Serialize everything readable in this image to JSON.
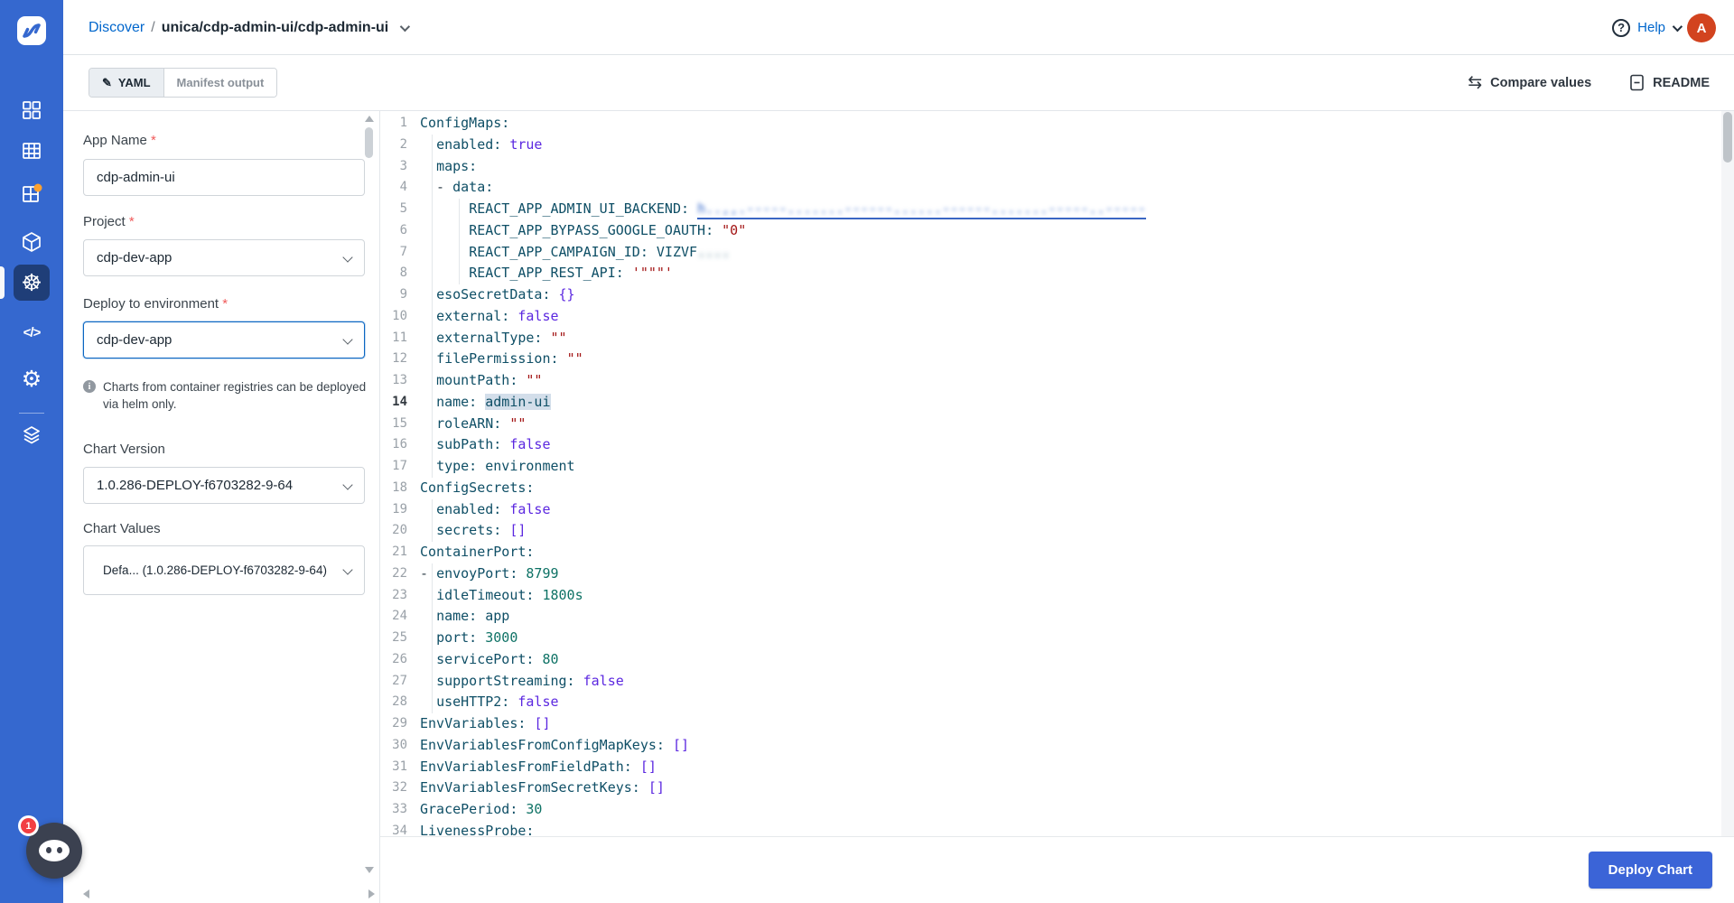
{
  "colors": {
    "sidebar_blue": "#3568cf",
    "sidebar_active_bg": "#1f3e78",
    "link_blue": "#0066cc",
    "deploy_button_blue": "#3b64d7",
    "avatar_orange": "#d2431f",
    "notification_dot_orange": "#fca130",
    "badge_red": "#f23f43",
    "code_key": "#0f4f66",
    "code_atom": "#5b27e0",
    "code_number": "#0e7265",
    "code_string": "#a31515",
    "code_selection_bg": "#d3deea"
  },
  "sidebar": {
    "icons": [
      "devtron-logo",
      "apps-grid-icon",
      "chart-store-icon",
      "deployment-groups-icon",
      "resource-cube-icon",
      "helm-wheel-icon",
      "code-icon",
      "gear-icon",
      "stack-icon"
    ],
    "active_item": "helm-wheel-icon"
  },
  "header": {
    "breadcrumb": {
      "section": "Discover",
      "separator": "/",
      "path": "unica/cdp-admin-ui/cdp-admin-ui"
    },
    "help_label": "Help",
    "avatar_initial": "A"
  },
  "toolbar": {
    "yaml_tab": "YAML",
    "manifest_tab": "Manifest output",
    "compare_label": "Compare values",
    "readme_label": "README"
  },
  "form": {
    "app_name": {
      "label": "App Name",
      "required_mark": "*",
      "value": "cdp-admin-ui"
    },
    "project": {
      "label": "Project",
      "required_mark": "*",
      "value": "cdp-dev-app"
    },
    "environment": {
      "label": "Deploy to environment",
      "required_mark": "*",
      "value": "cdp-dev-app"
    },
    "note": "Charts from container registries can be deployed via helm only.",
    "chart_version": {
      "label": "Chart Version",
      "value": "1.0.286-DEPLOY-f6703282-9-64"
    },
    "chart_values": {
      "label": "Chart Values",
      "value": "Defa... (1.0.286-DEPLOY-f6703282-9-64)"
    }
  },
  "editor": {
    "lines": [
      {
        "n": 1,
        "seg": [
          [
            "key",
            "ConfigMaps:"
          ]
        ]
      },
      {
        "n": 2,
        "seg": [
          [
            "pln",
            "  "
          ],
          [
            "key",
            "enabled:"
          ],
          [
            "pln",
            " "
          ],
          [
            "atm",
            "true"
          ]
        ]
      },
      {
        "n": 3,
        "seg": [
          [
            "pln",
            "  "
          ],
          [
            "key",
            "maps:"
          ]
        ]
      },
      {
        "n": 4,
        "seg": [
          [
            "pln",
            "  - "
          ],
          [
            "key",
            "data:"
          ]
        ]
      },
      {
        "n": 5,
        "seg": [
          [
            "pln",
            "      "
          ],
          [
            "key",
            "REACT_APP_ADMIN_UI_BACKEND:"
          ],
          [
            "pln",
            " "
          ],
          [
            "lnk",
            "h..,,.-----.......------......------.......-----..-----"
          ]
        ]
      },
      {
        "n": 6,
        "seg": [
          [
            "pln",
            "      "
          ],
          [
            "key",
            "REACT_APP_BYPASS_GOOGLE_OAUTH:"
          ],
          [
            "pln",
            " "
          ],
          [
            "str",
            "\"0\""
          ]
        ]
      },
      {
        "n": 7,
        "seg": [
          [
            "pln",
            "      "
          ],
          [
            "key",
            "REACT_APP_CAMPAIGN_ID:"
          ],
          [
            "pln",
            " "
          ],
          [
            "val",
            "VIZVF"
          ],
          [
            "blr",
            "...."
          ]
        ]
      },
      {
        "n": 8,
        "seg": [
          [
            "pln",
            "      "
          ],
          [
            "key",
            "REACT_APP_REST_API:"
          ],
          [
            "pln",
            " "
          ],
          [
            "str",
            "'\"\"\"'"
          ]
        ]
      },
      {
        "n": 9,
        "seg": [
          [
            "pln",
            "  "
          ],
          [
            "key",
            "esoSecretData:"
          ],
          [
            "pln",
            " "
          ],
          [
            "atm",
            "{}"
          ]
        ]
      },
      {
        "n": 10,
        "seg": [
          [
            "pln",
            "  "
          ],
          [
            "key",
            "external:"
          ],
          [
            "pln",
            " "
          ],
          [
            "atm",
            "false"
          ]
        ]
      },
      {
        "n": 11,
        "seg": [
          [
            "pln",
            "  "
          ],
          [
            "key",
            "externalType:"
          ],
          [
            "pln",
            " "
          ],
          [
            "str",
            "\"\""
          ]
        ]
      },
      {
        "n": 12,
        "seg": [
          [
            "pln",
            "  "
          ],
          [
            "key",
            "filePermission:"
          ],
          [
            "pln",
            " "
          ],
          [
            "str",
            "\"\""
          ]
        ]
      },
      {
        "n": 13,
        "seg": [
          [
            "pln",
            "  "
          ],
          [
            "key",
            "mountPath:"
          ],
          [
            "pln",
            " "
          ],
          [
            "str",
            "\"\""
          ]
        ]
      },
      {
        "n": 14,
        "active": true,
        "seg": [
          [
            "pln",
            "  "
          ],
          [
            "key",
            "name:"
          ],
          [
            "pln",
            " "
          ],
          [
            "hil",
            "admin-ui"
          ]
        ]
      },
      {
        "n": 15,
        "seg": [
          [
            "pln",
            "  "
          ],
          [
            "key",
            "roleARN:"
          ],
          [
            "pln",
            " "
          ],
          [
            "str",
            "\"\""
          ]
        ]
      },
      {
        "n": 16,
        "seg": [
          [
            "pln",
            "  "
          ],
          [
            "key",
            "subPath:"
          ],
          [
            "pln",
            " "
          ],
          [
            "atm",
            "false"
          ]
        ]
      },
      {
        "n": 17,
        "seg": [
          [
            "pln",
            "  "
          ],
          [
            "key",
            "type:"
          ],
          [
            "pln",
            " "
          ],
          [
            "val",
            "environment"
          ]
        ]
      },
      {
        "n": 18,
        "seg": [
          [
            "key",
            "ConfigSecrets:"
          ]
        ]
      },
      {
        "n": 19,
        "seg": [
          [
            "pln",
            "  "
          ],
          [
            "key",
            "enabled:"
          ],
          [
            "pln",
            " "
          ],
          [
            "atm",
            "false"
          ]
        ]
      },
      {
        "n": 20,
        "seg": [
          [
            "pln",
            "  "
          ],
          [
            "key",
            "secrets:"
          ],
          [
            "pln",
            " "
          ],
          [
            "atm",
            "[]"
          ]
        ]
      },
      {
        "n": 21,
        "seg": [
          [
            "key",
            "ContainerPort:"
          ]
        ]
      },
      {
        "n": 22,
        "seg": [
          [
            "pln",
            "- "
          ],
          [
            "key",
            "envoyPort:"
          ],
          [
            "pln",
            " "
          ],
          [
            "num",
            "8799"
          ]
        ]
      },
      {
        "n": 23,
        "seg": [
          [
            "pln",
            "  "
          ],
          [
            "key",
            "idleTimeout:"
          ],
          [
            "pln",
            " "
          ],
          [
            "num",
            "1800s"
          ]
        ]
      },
      {
        "n": 24,
        "seg": [
          [
            "pln",
            "  "
          ],
          [
            "key",
            "name:"
          ],
          [
            "pln",
            " "
          ],
          [
            "val",
            "app"
          ]
        ]
      },
      {
        "n": 25,
        "seg": [
          [
            "pln",
            "  "
          ],
          [
            "key",
            "port:"
          ],
          [
            "pln",
            " "
          ],
          [
            "num",
            "3000"
          ]
        ]
      },
      {
        "n": 26,
        "seg": [
          [
            "pln",
            "  "
          ],
          [
            "key",
            "servicePort:"
          ],
          [
            "pln",
            " "
          ],
          [
            "num",
            "80"
          ]
        ]
      },
      {
        "n": 27,
        "seg": [
          [
            "pln",
            "  "
          ],
          [
            "key",
            "supportStreaming:"
          ],
          [
            "pln",
            " "
          ],
          [
            "atm",
            "false"
          ]
        ]
      },
      {
        "n": 28,
        "seg": [
          [
            "pln",
            "  "
          ],
          [
            "key",
            "useHTTP2:"
          ],
          [
            "pln",
            " "
          ],
          [
            "atm",
            "false"
          ]
        ]
      },
      {
        "n": 29,
        "seg": [
          [
            "key",
            "EnvVariables:"
          ],
          [
            "pln",
            " "
          ],
          [
            "atm",
            "[]"
          ]
        ]
      },
      {
        "n": 30,
        "seg": [
          [
            "key",
            "EnvVariablesFromConfigMapKeys:"
          ],
          [
            "pln",
            " "
          ],
          [
            "atm",
            "[]"
          ]
        ]
      },
      {
        "n": 31,
        "seg": [
          [
            "key",
            "EnvVariablesFromFieldPath:"
          ],
          [
            "pln",
            " "
          ],
          [
            "atm",
            "[]"
          ]
        ]
      },
      {
        "n": 32,
        "seg": [
          [
            "key",
            "EnvVariablesFromSecretKeys:"
          ],
          [
            "pln",
            " "
          ],
          [
            "atm",
            "[]"
          ]
        ]
      },
      {
        "n": 33,
        "seg": [
          [
            "key",
            "GracePeriod:"
          ],
          [
            "pln",
            " "
          ],
          [
            "num",
            "30"
          ]
        ]
      },
      {
        "n": 34,
        "seg": [
          [
            "key",
            "LivenessProbe:"
          ]
        ]
      }
    ],
    "guides": [
      {
        "x": 57,
        "from": 2,
        "to": 17
      },
      {
        "x": 87,
        "from": 5,
        "to": 8
      },
      {
        "x": 57,
        "from": 19,
        "to": 20
      },
      {
        "x": 57,
        "from": 22,
        "to": 28
      }
    ]
  },
  "footer": {
    "deploy_label": "Deploy Chart"
  },
  "chat_widget": {
    "badge": "1"
  }
}
